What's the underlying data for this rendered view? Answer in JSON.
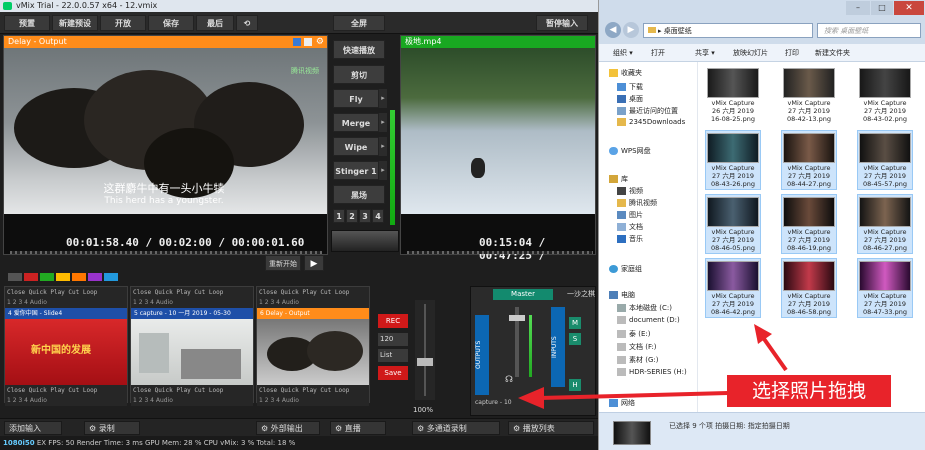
{
  "vmix": {
    "title": "vMix Trial - 22.0.0.57 x64 - 12.vmix",
    "menu": {
      "preset": "预置",
      "new_preset": "新建预设",
      "open": "开放",
      "save": "保存",
      "recent": "最后",
      "fullscreen": "全屏",
      "pause_input": "暂停输入"
    },
    "preview": {
      "title": "Delay - Output",
      "subtitle_cn": "这群麝牛中有一头小牛犊",
      "subtitle_en": "This herd has a youngster.",
      "timecode": "00:01:58.40 / 00:02:00 / 00:00:01.60",
      "watermark": "腾讯视频"
    },
    "program": {
      "title": "极地.mp4",
      "timecode": "00:15:04 / 00:47:25 /"
    },
    "transitions": {
      "quick_play": "快速播放",
      "cut": "剪切",
      "fly": "Fly",
      "merge": "Merge",
      "wipe": "Wipe",
      "stinger": "Stinger 1",
      "black": "黑场",
      "pages": [
        "1",
        "2",
        "3",
        "4"
      ]
    },
    "restart_label": "重新开始",
    "source_bars": [
      {
        "controls": "Close  Quick Play  Cut  Loop",
        "nums": "1  2  3  4   Audio"
      },
      {
        "controls": "Close  Quick Play  Cut  Loop",
        "nums": "1  2  3  4   Audio"
      },
      {
        "controls": "Close  Quick Play  Cut  Loop",
        "nums": "1  2  3  4   Audio"
      }
    ],
    "sources": [
      {
        "title": "4  爱你中国 - Slide4",
        "headline": "新中国的发展",
        "color": "#1e4fa8"
      },
      {
        "title": "5  capture - 10 一月 2019 - 05-30",
        "color": "#1e4fa8"
      },
      {
        "title": "6  Delay - Output",
        "color": "#ff8c1a"
      }
    ],
    "rec": {
      "rec": "REC",
      "q1": "120",
      "q2": "List",
      "save": "Save"
    },
    "zoom": "100%",
    "audio": {
      "master": "Master",
      "outputs": "OUTPUTS",
      "inputs": "INPUTS",
      "capture": "capture - 10",
      "small_title": "一沙之棋",
      "buttons": [
        "M",
        "S",
        "H"
      ]
    },
    "bottom": {
      "add_input": "添加输入",
      "record": "录制",
      "external": "外部输出",
      "stream": "直播",
      "multi": "多通道录制",
      "playlist": "播放列表"
    },
    "status": {
      "res": "1080i50",
      "fields": "EX  FPS: 50  Render Time: 3 ms  GPU Mem: 28 %  CPU vMix: 3 %  Total: 18 %"
    }
  },
  "explorer": {
    "breadcrumb": "▸ 桌面壁纸",
    "search_placeholder": "搜索 桌面壁纸",
    "toolbar": {
      "organize": "组织 ▾",
      "open": "打开",
      "share": "共享 ▾",
      "slideshow": "放映幻灯片",
      "print": "打印",
      "new_folder": "新建文件夹"
    },
    "nav": {
      "favorites": "收藏夹",
      "fav_items": [
        "下载",
        "桌面",
        "最近访问的位置",
        "2345Downloads"
      ],
      "wps": "WPS网盘",
      "library": "库",
      "lib_items": [
        "视频",
        "腾讯视频",
        "图片",
        "文档",
        "音乐"
      ],
      "homegroup": "家庭组",
      "computer": "电脑",
      "drives": [
        "本地磁盘 (C:)",
        "document (D:)",
        "泰 (E:)",
        "文档 (F:)",
        "素材 (G:)",
        "HDR-SERIES (H:)"
      ],
      "network": "网络"
    },
    "files": [
      {
        "name": "vMix Capture",
        "date": "26 六月 2019",
        "time": "16-08-25.png",
        "selected": false
      },
      {
        "name": "vMix Capture",
        "date": "27 六月 2019",
        "time": "08-42-13.png",
        "selected": false
      },
      {
        "name": "vMix Capture",
        "date": "27 六月 2019",
        "time": "08-43-02.png",
        "selected": false
      },
      {
        "name": "vMix Capture",
        "date": "27 六月 2019",
        "time": "08-43-26.png",
        "selected": true
      },
      {
        "name": "vMix Capture",
        "date": "27 六月 2019",
        "time": "08-44-27.png",
        "selected": true
      },
      {
        "name": "vMix Capture",
        "date": "27 六月 2019",
        "time": "08-45-57.png",
        "selected": true
      },
      {
        "name": "vMix Capture",
        "date": "27 六月 2019",
        "time": "08-46-05.png",
        "selected": true
      },
      {
        "name": "vMix Capture",
        "date": "27 六月 2019",
        "time": "08-46-19.png",
        "selected": true
      },
      {
        "name": "vMix Capture",
        "date": "27 六月 2019",
        "time": "08-46-27.png",
        "selected": true
      },
      {
        "name": "vMix Capture",
        "date": "27 六月 2019",
        "time": "08-46-42.png",
        "selected": true
      },
      {
        "name": "vMix Capture",
        "date": "27 六月 2019",
        "time": "08-46-58.png",
        "selected": true
      },
      {
        "name": "vMix Capture",
        "date": "27 六月 2019",
        "time": "08-47-33.png",
        "selected": true
      }
    ],
    "details": "已选择 9 个项  拍摄日期: 指定拍摄日期"
  },
  "annotation": "选择照片拖拽"
}
